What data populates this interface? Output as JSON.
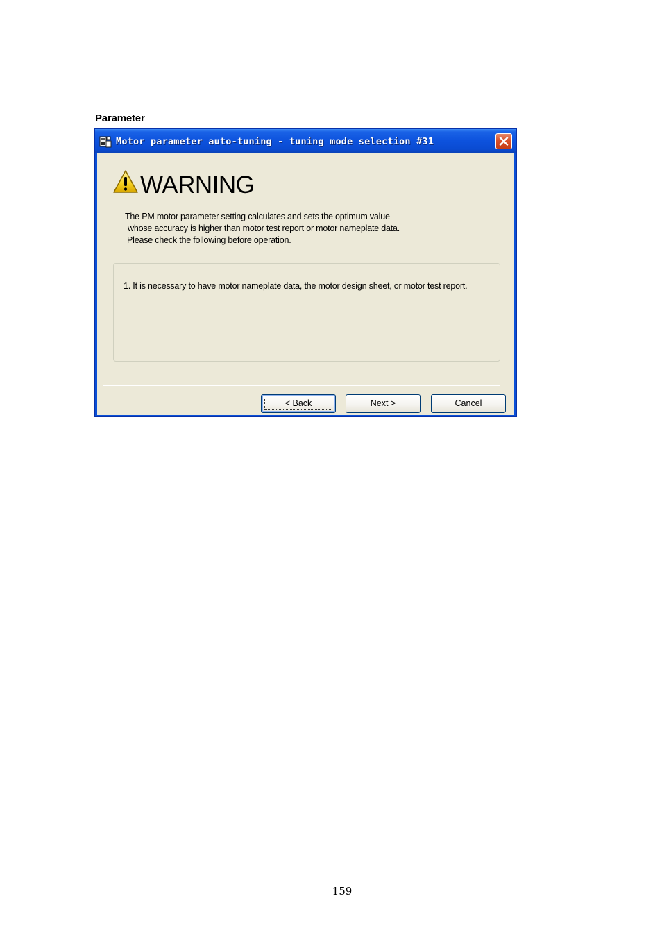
{
  "section_label": "Parameter",
  "dialog": {
    "title": "Motor parameter auto-tuning - tuning mode selection #31",
    "heading": "WARNING",
    "intro_lines": [
      "The PM motor parameter setting calculates and sets the optimum value",
      "whose accuracy is higher than motor test report or motor nameplate data.",
      "Please check the following before operation."
    ],
    "notes": [
      "1.  It is necessary to have motor nameplate data, the motor design sheet, or motor test report."
    ],
    "buttons": {
      "back": "< Back",
      "next": "Next >",
      "cancel": "Cancel"
    },
    "icons": {
      "app": "app-icon",
      "close": "close-icon",
      "warning": "warning-icon"
    }
  },
  "page_number": "159"
}
